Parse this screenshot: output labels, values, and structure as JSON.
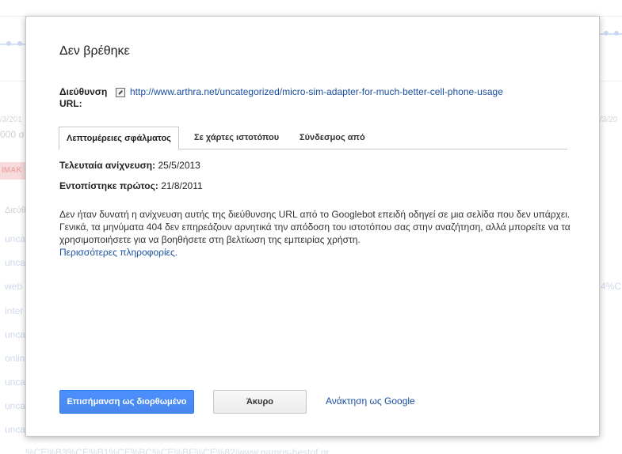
{
  "background": {
    "dates_left": "/3/201",
    "dates_right": "/3/20",
    "count_left": "000 σ",
    "red_badge": "ΙΜΑΚ",
    "column_header": "Διεύθ",
    "rows": [
      "unca",
      "unca",
      "web",
      "inter",
      "unca",
      "onlin",
      "unca",
      "unca",
      "unca"
    ],
    "row_right": "4%C",
    "footer_url": "%CE%B3%CE%B1%CE%BC%CE%BF%CE%82/www.gamos-bestof.gr"
  },
  "dialog": {
    "title": "Δεν βρέθηκε",
    "url_label": "Διεύθυνση URL:",
    "url": "http://www.arthra.net/uncategorized/micro-sim-adapter-for-much-better-cell-phone-usage",
    "tabs": [
      {
        "label": "Λεπτομέρειες σφάλματος",
        "active": true
      },
      {
        "label": "Σε χάρτες ιστοτόπου",
        "active": false
      },
      {
        "label": "Σύνδεσμος από",
        "active": false
      }
    ],
    "last_crawled_label": "Τελευταία ανίχνευση:",
    "last_crawled_value": "25/5/2013",
    "first_detected_label": "Εντοπίστηκε πρώτος:",
    "first_detected_value": "21/8/2011",
    "description": "Δεν ήταν δυνατή η ανίχνευση αυτής της διεύθυνσης URL από το Googlebot επειδή οδηγεί σε μια σελίδα που δεν υπάρχει. Γενικά, τα μηνύματα 404 δεν επηρεάζουν αρνητικά την απόδοση του ιστοτόπου σας στην αναζήτηση, αλλά μπορείτε να τα χρησιμοποιήσετε για να βοηθήσετε στη βελτίωση της εμπειρίας χρήστη.",
    "more_info": "Περισσότερες πληροφορίες.",
    "buttons": {
      "mark_fixed": "Επισήμανση ως διορθωμένο",
      "cancel": "Άκυρο",
      "fetch_as_google": "Ανάκτηση ως Google"
    }
  },
  "colors": {
    "primary_button": "#4d90fe",
    "link": "#1a4fa0"
  }
}
